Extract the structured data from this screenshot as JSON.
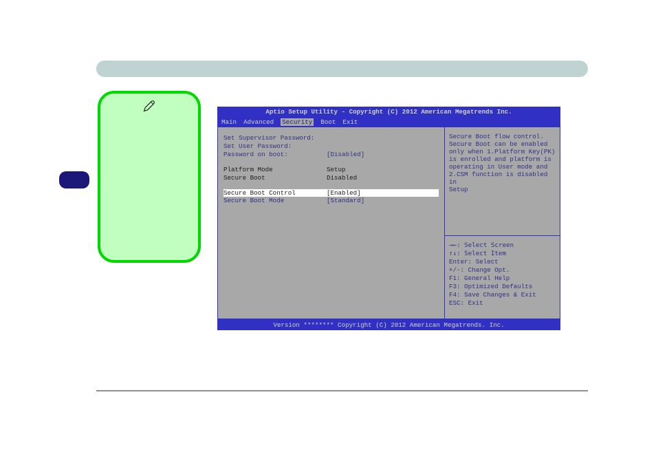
{
  "bios": {
    "title": "Aptio Setup Utility - Copyright (C) 2012 American Megatrends Inc.",
    "tabs": {
      "main": "Main",
      "advanced": "Advanced",
      "security": "Security",
      "boot": "Boot",
      "exit": "Exit"
    },
    "left": {
      "set_supervisor": "Set Supervisor Password:",
      "set_user": "Set User Password:",
      "password_on_boot_label": "Password on boot:",
      "password_on_boot_value": "[Disabled]",
      "platform_mode_label": "Platform Mode",
      "platform_mode_value": "Setup",
      "secure_boot_label": "Secure Boot",
      "secure_boot_value": "Disabled",
      "secure_boot_control_label": "Secure Boot Control",
      "secure_boot_control_value": "[Enabled]",
      "secure_boot_mode_label": "Secure Boot Mode",
      "secure_boot_mode_value": "[Standard]"
    },
    "help": {
      "l1": "Secure Boot flow control.",
      "l2": "Secure Boot can be enabled",
      "l3": "only when 1.Platform Key(PK)",
      "l4": "is enrolled and platform is",
      "l5": "operating in User mode and",
      "l6": "2.CSM function is disabled in",
      "l7": "Setup"
    },
    "keys": {
      "k1": "→←: Select Screen",
      "k2": "↑↓: Select Item",
      "k3": "Enter: Select",
      "k4": "+/-: Change Opt.",
      "k5": "F1: General Help",
      "k6": "F3: Optimized Defaults",
      "k7": "F4: Save Changes & Exit",
      "k8": "ESC: Exit"
    },
    "footer": "Version ******** Copyright (C) 2012 American Megatrends. Inc."
  }
}
